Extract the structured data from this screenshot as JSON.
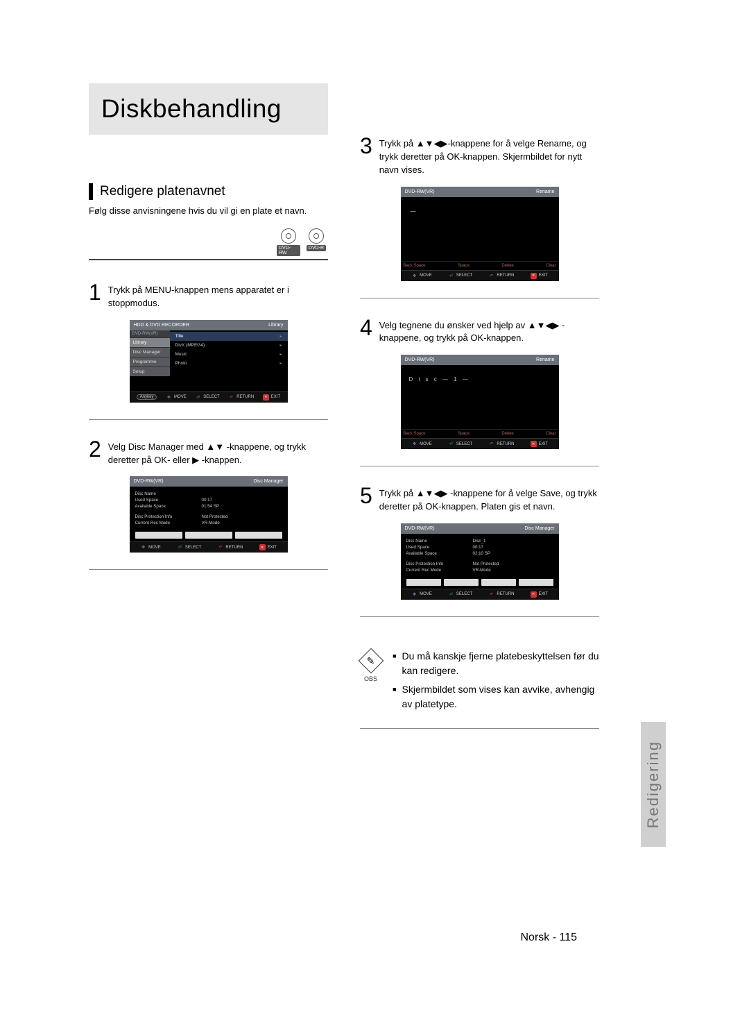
{
  "title": "Diskbehandling",
  "section": {
    "heading": "Redigere platenavnet",
    "intro": "Følg disse anvisningene hvis du vil gi en plate et navn.",
    "disc_badges": [
      "DVD-RW",
      "DVD-R"
    ]
  },
  "steps": {
    "s1": {
      "num": "1",
      "text": "Trykk på MENU-knappen mens apparatet er i stoppmodus."
    },
    "s2": {
      "num": "2",
      "text": "Velg Disc Manager med ▲▼ -knappene, og trykk deretter på OK- eller ▶ -knappen."
    },
    "s3": {
      "num": "3",
      "text": "Trykk på ▲▼◀▶-knappene for å velge Rename, og trykk deretter på OK-knappen. Skjermbildet for nytt navn vises."
    },
    "s4": {
      "num": "4",
      "text": "Velg tegnene du ønsker ved hjelp av ▲▼◀▶ -knappene, og trykk på OK-knappen."
    },
    "s5": {
      "num": "5",
      "text": "Trykk på ▲▼◀▶ -knappene for å velge Save, og trykk deretter på OK-knappen. Platen gis et navn."
    }
  },
  "screens": {
    "library": {
      "head_left": "HDD & DVD RECORDER",
      "head_right": "Library",
      "left_top": "DVD-RW(VR)",
      "left_items": [
        "Library",
        "Disc Manager",
        "Programme",
        "Setup"
      ],
      "right_items": [
        "Title",
        "DivX (MPEG4)",
        "Music",
        "Photo"
      ],
      "anykey": "Anykey"
    },
    "dm1": {
      "head_left": "DVD-RW(VR)",
      "head_right": "Disc Manager",
      "rows": [
        [
          "Disc Name",
          ""
        ],
        [
          "Used Space",
          "00:17"
        ],
        [
          "Available Space",
          "01:54 SP"
        ],
        [
          "",
          ""
        ],
        [
          "Disc Protection Info",
          "Not Protected"
        ],
        [
          "Current Rec Mode",
          "VR-Mode"
        ]
      ]
    },
    "rn1": {
      "head_left": "DVD-RW(VR)",
      "head_right": "Rename",
      "input": "",
      "fn": [
        "Back Space",
        "Space",
        "Delete",
        "Clear"
      ]
    },
    "rn2": {
      "head_left": "DVD-RW(VR)",
      "head_right": "Rename",
      "input": "D i s c — 1 —",
      "fn": [
        "Back Space",
        "Space",
        "Delete",
        "Clear"
      ]
    },
    "dm2": {
      "head_left": "DVD-RW(VR)",
      "head_right": "Disc Manager",
      "rows": [
        [
          "Disc Name",
          "Disc_1"
        ],
        [
          "Used Space",
          "00:17"
        ],
        [
          "Available Space",
          "02:10 SP"
        ],
        [
          "",
          ""
        ],
        [
          "Disc Protection Info",
          "Not Protected"
        ],
        [
          "Current Rec Mode",
          "VR-Mode"
        ]
      ]
    },
    "foot": {
      "move": "MOVE",
      "select": "SELECT",
      "return": "RETURN",
      "exit": "EXIT"
    }
  },
  "note": {
    "label": "OBS",
    "p1": "Du må kanskje fjerne platebeskyttelsen før du kan redigere.",
    "p2": "Skjermbildet som vises kan avvike, avhengig av platetype."
  },
  "side_tab": "Redigering",
  "page_footer": "Norsk - 115"
}
